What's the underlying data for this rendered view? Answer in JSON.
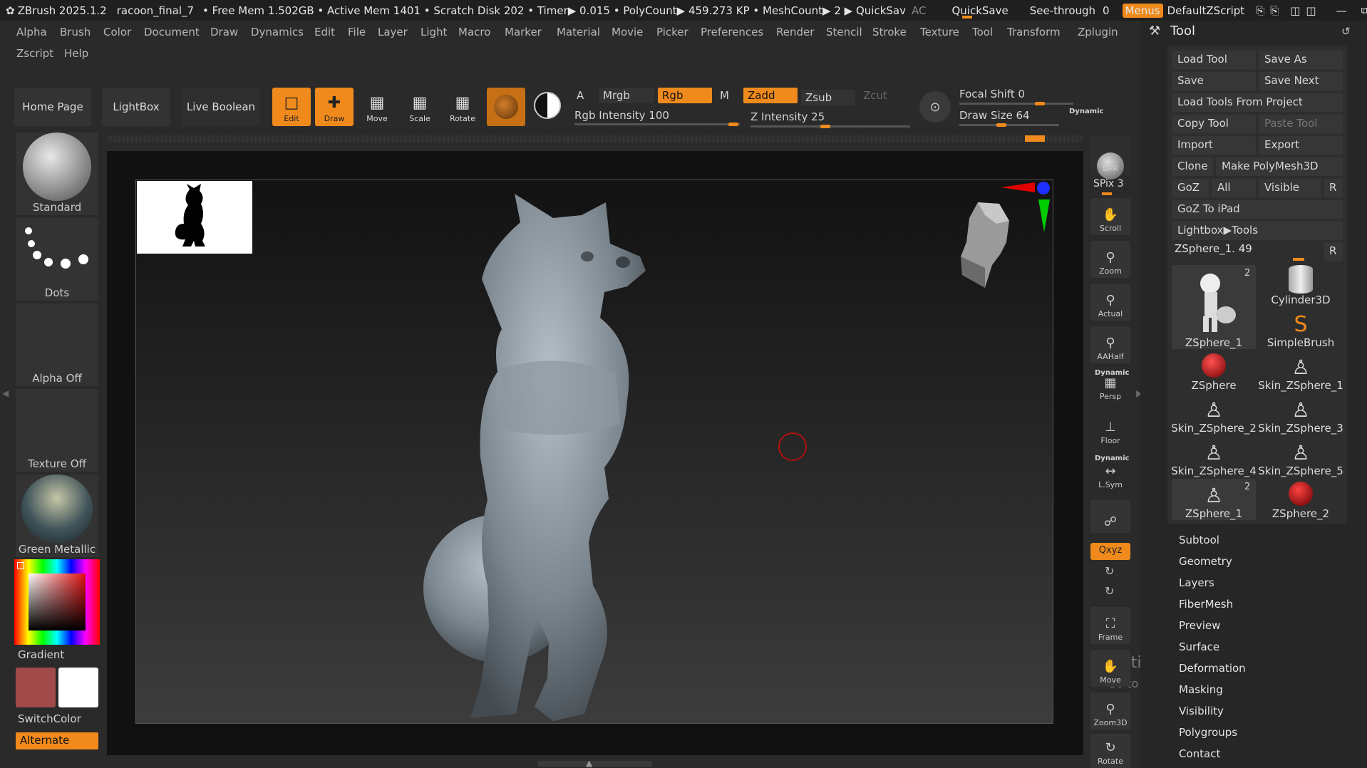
{
  "titlebar": {
    "app": "ZBrush 2025.1.2",
    "file": "racoon_final_7",
    "stats": "• Free Mem 1.502GB • Active Mem 1401 • Scratch Disk 202 • Timer▶ 0.015 • PolyCount▶ 459.273 KP • MeshCount▶ 2  ▶ QuickSav",
    "ac": "AC",
    "quicksave": "QuickSave",
    "seethrough": "See-through",
    "seethrough_value": "0",
    "menus": "Menus",
    "script": "DefaultZScript"
  },
  "menu": [
    "Alpha",
    "Brush",
    "Color",
    "Document",
    "Draw",
    "Dynamics",
    "Edit",
    "File",
    "Layer",
    "Light",
    "Macro",
    "Marker",
    "Material",
    "Movie",
    "Picker",
    "Preferences",
    "Render",
    "Stencil",
    "Stroke",
    "Texture",
    "Tool",
    "Transform",
    "Zplugin"
  ],
  "menu2": [
    "Zscript",
    "Help"
  ],
  "shelf": {
    "home": "Home Page",
    "lightbox": "LightBox",
    "liveboolean": "Live Boolean",
    "edit": "Edit",
    "draw": "Draw",
    "move": "Move",
    "scale": "Scale",
    "rotate": "Rotate",
    "a": "A",
    "mrgb": "Mrgb",
    "rgb": "Rgb",
    "m": "M",
    "zadd": "Zadd",
    "zsub": "Zsub",
    "zcut": "Zcut",
    "rgb_intensity": "Rgb Intensity 100",
    "z_intensity": "Z Intensity 25",
    "focal_shift": "Focal Shift 0",
    "draw_size": "Draw Size 64",
    "dynamic": "Dynamic",
    "rgb_intensity_value": 100,
    "z_intensity_value": 25,
    "focal_shift_value": 0,
    "draw_size_value": 64
  },
  "leftpanel": {
    "brush": "Standard",
    "stroke": "Dots",
    "alpha": "Alpha Off",
    "texture": "Texture Off",
    "material": "Green Metallic",
    "gradient": "Gradient",
    "switchcolor": "SwitchColor",
    "alternate": "Alternate"
  },
  "nav": {
    "bpr": "BPR",
    "spix": "SPix 3",
    "scroll": "Scroll",
    "zoom": "Zoom",
    "actual": "Actual",
    "aahalf": "AAHalf",
    "dynamic": "Dynamic",
    "persp": "Persp",
    "floor": "Floor",
    "dynamic2": "Dynamic",
    "lsym": "L.Sym",
    "xyz": "Qxyz",
    "frame": "Frame",
    "move": "Move",
    "zoom3d": "Zoom3D",
    "rotate": "Rotate"
  },
  "tool": {
    "title": "Tool",
    "load_tool": "Load Tool",
    "save_as": "Save As",
    "save": "Save",
    "save_next": "Save Next",
    "load_from_project": "Load Tools From Project",
    "copy_tool": "Copy Tool",
    "paste_tool": "Paste Tool",
    "import": "Import",
    "export": "Export",
    "clone": "Clone",
    "make_polymesh": "Make PolyMesh3D",
    "goz": "GoZ",
    "all": "All",
    "visible": "Visible",
    "r": "R",
    "goz_ipad": "GoZ To iPad",
    "lightbox_tools": "Lightbox▶Tools",
    "current": "ZSphere_1. 49",
    "current_r": "R",
    "thumbs": [
      {
        "name": "ZSphere_1",
        "badge": "2"
      },
      {
        "name": "Cylinder3D",
        "badge": ""
      },
      {
        "name": "SimpleBrush",
        "badge": ""
      },
      {
        "name": "ZSphere",
        "badge": ""
      },
      {
        "name": "Skin_ZSphere_1",
        "badge": ""
      },
      {
        "name": "Skin_ZSphere_2",
        "badge": ""
      },
      {
        "name": "Skin_ZSphere_3",
        "badge": ""
      },
      {
        "name": "Skin_ZSphere_4",
        "badge": ""
      },
      {
        "name": "Skin_ZSphere_5",
        "badge": ""
      },
      {
        "name": "ZSphere_1",
        "badge": "2"
      },
      {
        "name": "ZSphere_2",
        "badge": ""
      }
    ],
    "subpalettes": [
      "Subtool",
      "Geometry",
      "Layers",
      "FiberMesh",
      "Preview",
      "Surface",
      "Deformation",
      "Masking",
      "Visibility",
      "Polygroups",
      "Contact"
    ]
  },
  "watermark": {
    "line1": "Activate Windows",
    "line2": "Go to Settings to activate Windows."
  },
  "colors": {
    "accent": "#f08a1c",
    "bg": "#2a2a2a",
    "panel": "#262626",
    "mesh": "#8e9aa3"
  }
}
